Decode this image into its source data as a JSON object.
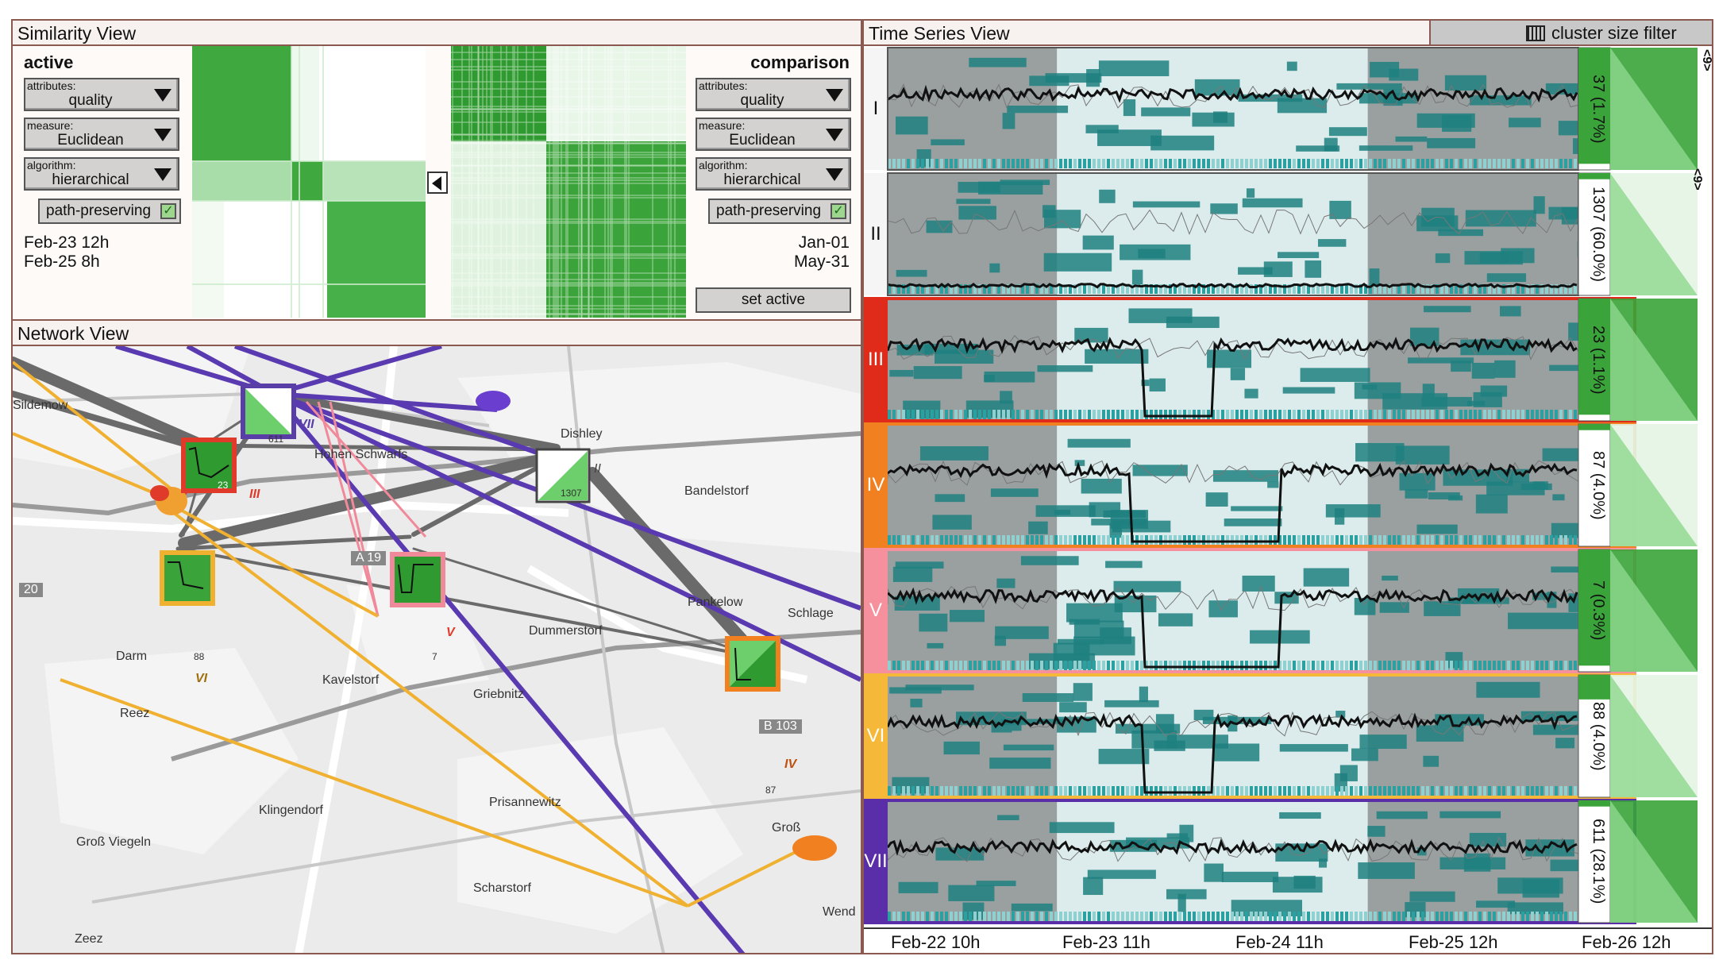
{
  "similarity": {
    "title": "Similarity View",
    "active": {
      "heading": "active",
      "attributes_label": "attributes:",
      "attributes_value": "quality",
      "measure_label": "measure:",
      "measure_value": "Euclidean",
      "algorithm_label": "algorithm:",
      "algorithm_value": "hierarchical",
      "path_label": "path-preserving",
      "range_start": "Feb-23 12h",
      "range_end": "Feb-25 8h"
    },
    "comparison": {
      "heading": "comparison",
      "attributes_label": "attributes:",
      "attributes_value": "quality",
      "measure_label": "measure:",
      "measure_value": "Euclidean",
      "algorithm_label": "algorithm:",
      "algorithm_value": "hierarchical",
      "path_label": "path-preserving",
      "range_start": "Jan-01",
      "range_end": "May-31",
      "set_active_label": "set active"
    }
  },
  "network": {
    "title": "Network View",
    "places": [
      "Dishley",
      "Hohen Schwarfs",
      "Bandelstorf",
      "Pankelow",
      "Schlage",
      "Dummerstorf",
      "Darm",
      "Kavelstorf",
      "Griebnitz",
      "Reez",
      "Klingendorf",
      "Prisannewitz",
      "Groß Viegeln",
      "Scharstorf",
      "Wend",
      "Zeez",
      "Sildemow",
      "Groß",
      "20",
      "A 19",
      "B 103"
    ],
    "nodes": [
      {
        "id": "VII",
        "count": "611",
        "color": "#5a3ea8"
      },
      {
        "id": "III",
        "count": "23",
        "color": "#e03a2a"
      },
      {
        "id": "II",
        "count": "1307",
        "color": "#555555"
      },
      {
        "id": "VI",
        "count": "88",
        "color": "#f0b030"
      },
      {
        "id": "V",
        "count": "7",
        "color": "#f08a9a"
      },
      {
        "id": "IV",
        "count": "87",
        "color": "#f08020"
      }
    ]
  },
  "timeseries": {
    "title": "Time Series View",
    "filter_label": "cluster size filter",
    "clusters": [
      {
        "id": "I",
        "count": "37 (1.7%)",
        "color": "#f5f5f5"
      },
      {
        "id": "II",
        "count": "1307 (60.0%)",
        "color": "#f5f5f5"
      },
      {
        "id": "III",
        "count": "23 (1.1%)",
        "color": "#e02a1a"
      },
      {
        "id": "IV",
        "count": "87 (4.0%)",
        "color": "#f08020"
      },
      {
        "id": "V",
        "count": "7 (0.3%)",
        "color": "#f5909c"
      },
      {
        "id": "VI",
        "count": "88 (4.0%)",
        "color": "#f5b838"
      },
      {
        "id": "VII",
        "count": "611 (28.1%)",
        "color": "#5a2ea8"
      }
    ],
    "ticks": [
      "Feb-22 10h",
      "Feb-23 11h",
      "Feb-24 11h",
      "Feb-25 12h",
      "Feb-26 12h"
    ],
    "tree_labels": [
      "<9>",
      "<9>"
    ]
  }
}
